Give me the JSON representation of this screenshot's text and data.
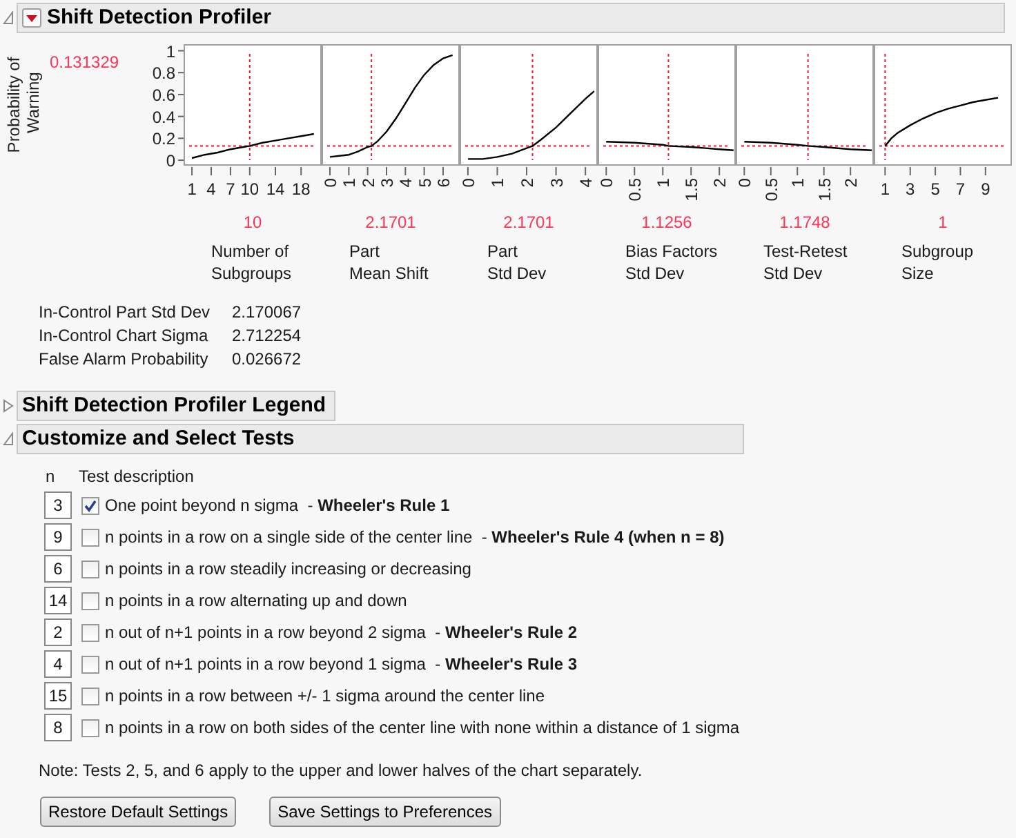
{
  "profiler": {
    "title": "Shift Detection Profiler",
    "expanded": true,
    "response_value": "0.131329",
    "charts": [
      {
        "chart_data": {
          "type": "line",
          "ylabel": "Probability of Warning",
          "x": [
            1,
            3,
            5,
            7,
            9,
            10,
            12,
            14,
            16,
            18,
            20
          ],
          "values": [
            0.02,
            0.05,
            0.07,
            0.1,
            0.12,
            0.13,
            0.16,
            0.18,
            0.2,
            0.22,
            0.24
          ],
          "xlim": [
            -0.3,
            21.2
          ],
          "ylim": [
            -0.05,
            1.06
          ],
          "xticks": [
            1,
            4,
            7,
            10,
            14,
            18
          ],
          "yticks": [
            0,
            0.2,
            0.4,
            0.6,
            0.8,
            1
          ],
          "ref_lines": [
            {
              "axis": "x",
              "value": 10
            },
            {
              "axis": "y",
              "value": 0.13
            }
          ]
        }
      },
      {
        "chart_data": {
          "type": "line",
          "x": [
            0,
            0.5,
            1,
            1.5,
            2,
            2.2,
            2.5,
            3,
            3.5,
            4,
            4.5,
            5,
            5.5,
            6,
            6.5
          ],
          "values": [
            0.03,
            0.04,
            0.05,
            0.08,
            0.12,
            0.13,
            0.17,
            0.26,
            0.38,
            0.52,
            0.66,
            0.78,
            0.87,
            0.93,
            0.96
          ],
          "xlim": [
            -0.44,
            6.88
          ],
          "ylim": [
            -0.05,
            1.06
          ],
          "xticks": [
            0,
            1,
            2,
            3,
            4,
            5,
            6
          ],
          "ref_lines": [
            {
              "axis": "x",
              "value": 2.2
            },
            {
              "axis": "y",
              "value": 0.13
            }
          ]
        }
      },
      {
        "chart_data": {
          "type": "line",
          "x": [
            0,
            0.5,
            1,
            1.5,
            2,
            2.2,
            2.5,
            3,
            3.5,
            4,
            4.3
          ],
          "values": [
            0.01,
            0.01,
            0.03,
            0.06,
            0.11,
            0.13,
            0.19,
            0.3,
            0.43,
            0.56,
            0.63
          ],
          "xlim": [
            -0.28,
            4.42
          ],
          "ylim": [
            -0.05,
            1.06
          ],
          "xticks": [
            0,
            1,
            2,
            3,
            4
          ],
          "ref_lines": [
            {
              "axis": "x",
              "value": 2.2
            },
            {
              "axis": "y",
              "value": 0.13
            }
          ]
        }
      },
      {
        "chart_data": {
          "type": "line",
          "x": [
            0,
            0.5,
            1,
            1.1,
            1.5,
            2,
            2.25
          ],
          "values": [
            0.17,
            0.16,
            0.14,
            0.13,
            0.12,
            0.1,
            0.09
          ],
          "xlim": [
            -0.15,
            2.29
          ],
          "ylim": [
            -0.05,
            1.06
          ],
          "xticks": [
            0,
            0.5,
            1,
            1.5,
            2
          ],
          "ref_lines": [
            {
              "axis": "x",
              "value": 1.1
            },
            {
              "axis": "y",
              "value": 0.13
            }
          ]
        }
      },
      {
        "chart_data": {
          "type": "line",
          "x": [
            0,
            0.5,
            1,
            1.2,
            1.5,
            2,
            2.4
          ],
          "values": [
            0.17,
            0.16,
            0.14,
            0.13,
            0.12,
            0.1,
            0.09
          ],
          "xlim": [
            -0.16,
            2.44
          ],
          "ylim": [
            -0.05,
            1.06
          ],
          "xticks": [
            0,
            0.5,
            1,
            1.5,
            2
          ],
          "ref_lines": [
            {
              "axis": "x",
              "value": 1.2
            },
            {
              "axis": "y",
              "value": 0.13
            }
          ]
        }
      },
      {
        "chart_data": {
          "type": "line",
          "x": [
            1,
            1.5,
            2,
            3,
            4,
            5,
            6,
            7,
            8,
            9,
            10
          ],
          "values": [
            0.13,
            0.2,
            0.25,
            0.32,
            0.38,
            0.43,
            0.47,
            0.5,
            0.53,
            0.55,
            0.57
          ],
          "xlim": [
            0.1,
            11.1
          ],
          "ylim": [
            -0.05,
            1.06
          ],
          "xticks": [
            1,
            3,
            5,
            7,
            9
          ],
          "ref_lines": [
            {
              "axis": "x",
              "value": 1
            },
            {
              "axis": "y",
              "value": 0.13
            }
          ]
        }
      }
    ],
    "factors": [
      {
        "value": "10",
        "label_lines": [
          "Number of",
          "Subgroups"
        ]
      },
      {
        "value": "2.1701",
        "label_lines": [
          "Part",
          "Mean Shift"
        ]
      },
      {
        "value": "2.1701",
        "label_lines": [
          "Part",
          "Std Dev"
        ]
      },
      {
        "value": "1.1256",
        "label_lines": [
          "Bias Factors",
          "Std Dev"
        ]
      },
      {
        "value": "1.1748",
        "label_lines": [
          "Test-Retest",
          "Std Dev"
        ]
      },
      {
        "value": "1",
        "label_lines": [
          "Subgroup",
          "Size"
        ]
      }
    ],
    "stats": [
      {
        "label": "In-Control Part Std Dev",
        "value": "2.170067"
      },
      {
        "label": "In-Control Chart Sigma",
        "value": "2.712254"
      },
      {
        "label": "False Alarm Probability",
        "value": "0.026672"
      }
    ]
  },
  "legend_section": {
    "title": "Shift Detection Profiler Legend",
    "expanded": false
  },
  "tests_section": {
    "title": "Customize and Select Tests",
    "expanded": true,
    "columns": [
      "n",
      "Test description"
    ],
    "tests": [
      {
        "n": "3",
        "checked": true,
        "description": "One point beyond n sigma  - **Wheeler's Rule 1**"
      },
      {
        "n": "9",
        "checked": false,
        "description": "n points in a row on a single side of the center line  - **Wheeler's Rule 4 (when n = 8)**"
      },
      {
        "n": "6",
        "checked": false,
        "description": "n points in a row steadily increasing or decreasing"
      },
      {
        "n": "14",
        "checked": false,
        "description": "n points in a row alternating up and down"
      },
      {
        "n": "2",
        "checked": false,
        "description": "n out of n+1 points in a row beyond 2 sigma  - **Wheeler's Rule 2**"
      },
      {
        "n": "4",
        "checked": false,
        "description": "n out of n+1 points in a row beyond 1 sigma  - **Wheeler's Rule 3**"
      },
      {
        "n": "15",
        "checked": false,
        "description": "n points in a row between +/- 1 sigma around the center line"
      },
      {
        "n": "8",
        "checked": false,
        "description": "n points in a row on both sides of the center line with none within a distance of 1 sigma"
      }
    ],
    "note": "Note: Tests 2, 5, and 6 apply to the upper and lower halves of the chart separately.",
    "buttons": [
      "Restore Default Settings",
      "Save Settings to Preferences"
    ]
  }
}
